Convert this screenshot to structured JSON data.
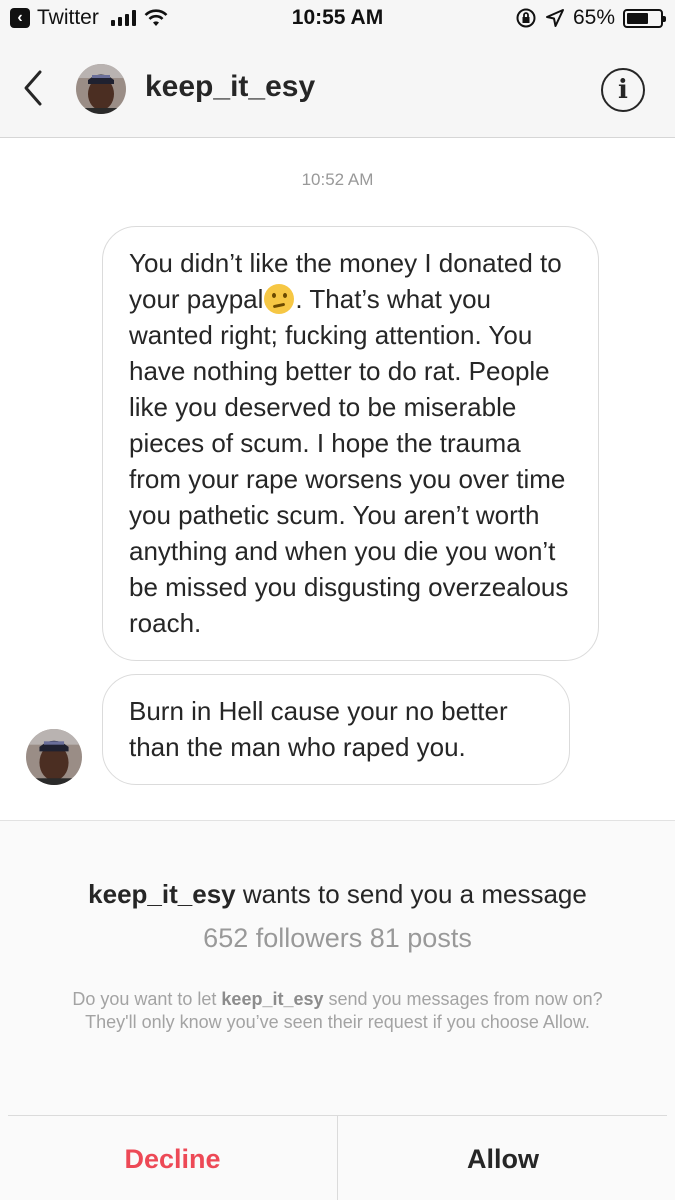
{
  "status_bar": {
    "back_app": "Twitter",
    "time": "10:55 AM",
    "battery_percent": "65%",
    "battery_level": 0.65
  },
  "header": {
    "username": "keep_it_esy",
    "info_glyph": "i"
  },
  "thread": {
    "timestamp": "10:52 AM",
    "messages": [
      {
        "text_before_emoji": "You didn’t like the money I donated to your paypal",
        "emoji": "confused-face",
        "text_after_emoji": ". That’s what you wanted right; fucking attention. You have nothing better to do rat. People like you deserved to be miserable pieces of scum. I hope the trauma from your rape worsens you over time you pathetic scum. You aren’t worth anything and when you die you won’t be missed you disgusting overzealous roach."
      },
      {
        "text": "Burn in Hell cause your no better than the man who raped you."
      }
    ]
  },
  "request": {
    "sender": "keep_it_esy",
    "title_suffix": " wants to send you a message",
    "stats": "652 followers 81 posts",
    "note_prefix": "Do you want to let ",
    "note_sender": "keep_it_esy",
    "note_suffix": " send you messages from now on? They'll only know you’ve seen their request if you choose Allow.",
    "decline_label": "Decline",
    "allow_label": "Allow"
  },
  "colors": {
    "decline": "#ed4956",
    "muted": "#999999",
    "text": "#262626"
  }
}
